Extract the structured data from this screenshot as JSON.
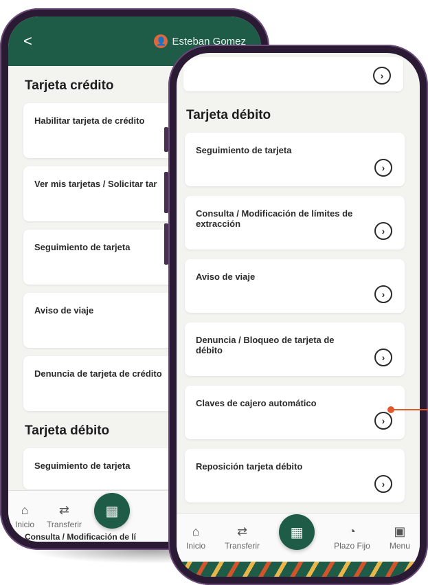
{
  "back_phone": {
    "header": {
      "back_icon": "<",
      "user_name": "Esteban Gomez"
    },
    "section_credit_title": "Tarjeta crédito",
    "credit_items": [
      "Habilitar tarjeta de crédito",
      "Ver mis tarjetas / Solicitar tar",
      "Seguimiento de tarjeta",
      "Aviso de viaje",
      "Denuncia de tarjeta de crédito"
    ],
    "section_debit_title": "Tarjeta débito",
    "debit_peek_item": "Seguimiento de tarjeta",
    "bottom_peek_item": "Consulta / Modificación de lí",
    "nav": {
      "home": "Inicio",
      "transfer": "Transferir"
    }
  },
  "front_phone": {
    "section_debit_title": "Tarjeta débito",
    "debit_items": [
      "Seguimiento de tarjeta",
      "Consulta / Modificación de límites de extracción",
      "Aviso de viaje",
      "Denuncia / Bloqueo de tarjeta de débito",
      "Claves de cajero automático",
      "Reposición tarjeta débito"
    ],
    "nav": {
      "home": "Inicio",
      "transfer": "Transferir",
      "fixed_term": "Plazo Fijo",
      "menu": "Menu"
    }
  },
  "icons": [
    "chevron-right-icon",
    "home-icon",
    "transfer-icon",
    "qr-icon",
    "piggy-bank-icon",
    "menu-grid-icon",
    "user-icon",
    "back-icon"
  ],
  "colors": {
    "brand_green": "#1f5c48",
    "accent_orange": "#e2582a",
    "phone_frame": "#2b1a33"
  }
}
